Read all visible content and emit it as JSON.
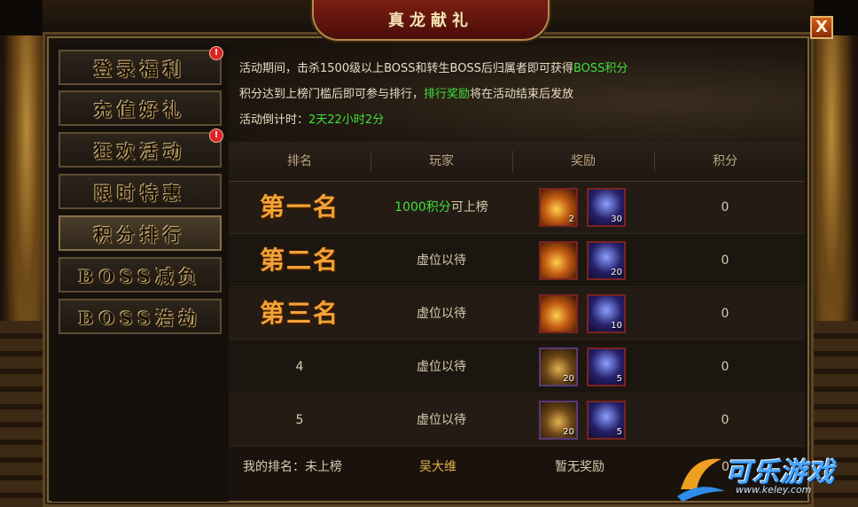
{
  "window": {
    "title": "真龙献礼",
    "close_label": "X"
  },
  "sidebar": {
    "items": [
      {
        "label": "登录福利",
        "alert": "!"
      },
      {
        "label": "充值好礼",
        "alert": ""
      },
      {
        "label": "狂欢活动",
        "alert": "!"
      },
      {
        "label": "限时特惠",
        "alert": ""
      },
      {
        "label": "积分排行",
        "alert": ""
      },
      {
        "label": "BOSS减负",
        "alert": ""
      },
      {
        "label": "BOSS浩劫",
        "alert": ""
      }
    ],
    "active_index": 4
  },
  "info": {
    "line1_a": "活动期间，击杀1500级以上BOSS和转生BOSS后归属者即可获得",
    "line1_b": "BOSS积分",
    "line2_a": "积分达到上榜门槛后即可参与排行，",
    "line2_b": "排行奖励",
    "line2_c": "将在活动结束后发放",
    "countdown_label": "活动倒计时：",
    "countdown_value": "2天22小时2分"
  },
  "table": {
    "headers": [
      "排名",
      "玩家",
      "奖励",
      "积分"
    ],
    "rows": [
      {
        "rank": "第一名",
        "player_a": "1000积分",
        "player_b": "可上榜",
        "reward1": "2",
        "reward1_type": "potion",
        "reward2": "30",
        "score": "0"
      },
      {
        "rank": "第二名",
        "player_a": "",
        "player_b": "虚位以待",
        "reward1": "",
        "reward1_type": "potion",
        "reward2": "20",
        "score": "0"
      },
      {
        "rank": "第三名",
        "player_a": "",
        "player_b": "虚位以待",
        "reward1": "",
        "reward1_type": "potion",
        "reward2": "10",
        "score": "0"
      },
      {
        "rank": "4",
        "player_a": "",
        "player_b": "虚位以待",
        "reward1": "20",
        "reward1_type": "chest",
        "reward2": "5",
        "score": "0"
      },
      {
        "rank": "5",
        "player_a": "",
        "player_b": "虚位以待",
        "reward1": "20",
        "reward1_type": "chest",
        "reward2": "5",
        "score": "0"
      }
    ]
  },
  "footer": {
    "my_rank_label": "我的排名：未上榜",
    "player_name": "吴大维",
    "reward_text": "暂无奖励",
    "score": "0"
  },
  "watermark": {
    "text": "可乐游戏",
    "url": "www.keley.com"
  }
}
